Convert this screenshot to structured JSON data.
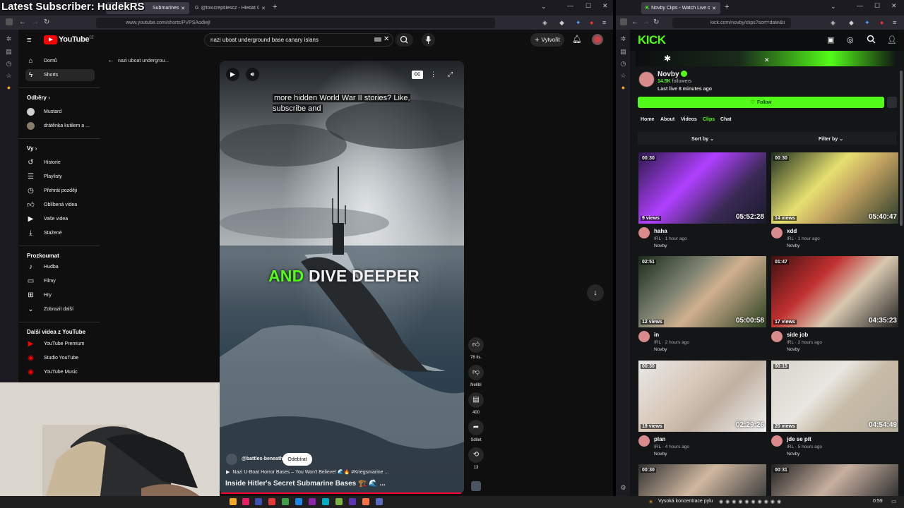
{
  "overlay": {
    "text": "Latest Subscriber: HudekRS"
  },
  "left_browser": {
    "tabs": [
      {
        "label": "Submarines"
      },
      {
        "label": "@toxicreptilescz - Hledat Goog"
      }
    ],
    "url": "www.youtube.com/shorts/PVPSAodiejI"
  },
  "youtube": {
    "logo": "YouTube",
    "logo_sup": "CZ",
    "search_value": "nazi uboat underground base canary islans",
    "create_label": "Vytvořit",
    "sidebar": {
      "main": [
        {
          "label": "Domů",
          "icon": "home-icon"
        },
        {
          "label": "Shorts",
          "icon": "shorts-icon"
        }
      ],
      "subs_title": "Odběry",
      "subs": [
        {
          "label": "Mustard",
          "color": "#d0d0d0"
        },
        {
          "label": "drátěnka kutilem a ...",
          "color": "#8a7a6a"
        }
      ],
      "you_title": "Vy",
      "you": [
        {
          "label": "Historie",
          "icon": "history-icon"
        },
        {
          "label": "Playlisty",
          "icon": "playlist-icon"
        },
        {
          "label": "Přehrát později",
          "icon": "clock-icon"
        },
        {
          "label": "Oblíbená videa",
          "icon": "thumbs-up-icon"
        },
        {
          "label": "Vaše videa",
          "icon": "video-icon"
        },
        {
          "label": "Stažené",
          "icon": "download-icon"
        }
      ],
      "explore_title": "Prozkoumat",
      "explore": [
        {
          "label": "Hudba",
          "icon": "music-icon"
        },
        {
          "label": "Filmy",
          "icon": "film-icon"
        },
        {
          "label": "Hry",
          "icon": "gamepad-icon"
        },
        {
          "label": "Zobrazit další",
          "icon": "chevron-down-icon"
        }
      ],
      "more_title": "Další videa z YouTube",
      "more": [
        {
          "label": "YouTube Premium"
        },
        {
          "label": "Studio YouTube"
        },
        {
          "label": "YouTube Music"
        }
      ]
    },
    "short": {
      "back_label": "nazi uboat undergrou...",
      "caption_top": "more hidden World War II stories? Like, subscribe and",
      "caption_big_green": "AND",
      "caption_big_white": "DIVE DEEPER",
      "channel": "@battles-beneath",
      "subscribe_label": "Odebírat",
      "music": "Nazi U-Boat Horror Bases – You Won't Believe! 🌊🔥 #Kriegsmarine ...",
      "title": "Inside Hitler's Secret Submarine Bases 🏗️ 🌊 ...",
      "cc_label": "CC",
      "actions": {
        "like_count": "76 tis.",
        "dislike_label": "Nelíbí",
        "comments_count": "400",
        "share_label": "Sdílet",
        "remix_count": "13"
      }
    }
  },
  "right_browser": {
    "tab": "Novby Clips - Watch Live on Ki",
    "url": "kick.com/novby/clips?sort=date&ti"
  },
  "kick": {
    "logo": "KICK",
    "channel": "Novby",
    "followers_count": "14.5K",
    "followers_label": "followers",
    "last_live": "Last live 8 minutes ago",
    "follow_label": "Follow",
    "tabs": [
      "Home",
      "About",
      "Videos",
      "Clips",
      "Chat"
    ],
    "active_tab": "Clips",
    "sort_label": "Sort by",
    "filter_label": "Filter by",
    "clips": [
      {
        "duration": "00:30",
        "views": "9 views",
        "timestamp": "05:52:28",
        "title": "haha",
        "meta": "IRL · 1 hour ago",
        "user": "Novby",
        "bg": "linear-gradient(135deg,#2b1a4a,#b040ff 40%,#3a2a55 70%,#1a1a2a)"
      },
      {
        "duration": "00:30",
        "views": "14 views",
        "timestamp": "05:40:47",
        "title": "xdd",
        "meta": "IRL · 1 hour ago",
        "user": "Novby",
        "bg": "linear-gradient(135deg,#203020,#e6e070 40%,#c0a060 60%,#2a3a2a)"
      },
      {
        "duration": "02:51",
        "views": "12 views",
        "timestamp": "05:00:58",
        "title": "in",
        "meta": "IRL · 2 hours ago",
        "user": "Novby",
        "bg": "linear-gradient(135deg,#1a2a1a,#7a8070 35%,#d0b090 55%,#2a4020)"
      },
      {
        "duration": "01:47",
        "views": "17 views",
        "timestamp": "04:35:23",
        "title": "side job",
        "meta": "IRL · 2 hours ago",
        "user": "Novby",
        "bg": "linear-gradient(135deg,#401010,#c03030 35%,#d8c8b0 60%,#202020)"
      },
      {
        "duration": "00:30",
        "views": "19 views",
        "timestamp": "02:29:26",
        "title": "plan",
        "meta": "IRL · 4 hours ago",
        "user": "Novby",
        "bg": "linear-gradient(135deg,#e8e8e8,#d8c8b8 40%,#c0b0a0 60%,#f0f0f0)"
      },
      {
        "duration": "00:15",
        "views": "20 views",
        "timestamp": "04:54:49",
        "title": "jde se pít",
        "meta": "IRL · 5 hours ago",
        "user": "Novby",
        "bg": "linear-gradient(135deg,#d8d4cc,#e8e6e0 40%,#c8bca8 60%,#b8b0a0)"
      },
      {
        "duration": "00:30",
        "views": "",
        "timestamp": "",
        "title": "",
        "meta": "",
        "user": "",
        "bg": "linear-gradient(135deg,#303030,#d0b8a0 50%,#404040)"
      },
      {
        "duration": "00:31",
        "views": "",
        "timestamp": "",
        "title": "",
        "meta": "",
        "user": "",
        "bg": "linear-gradient(135deg,#202020,#c8b0a0 50%,#303030)"
      }
    ]
  },
  "taskbar": {
    "weather": "Vysoká koncentrace pylu",
    "clock": "0:59"
  }
}
